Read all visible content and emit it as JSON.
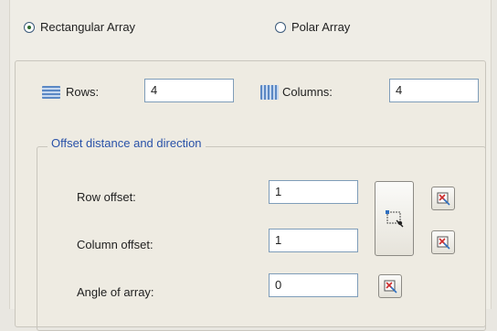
{
  "array_type": {
    "rectangular_label": "Rectangular Array",
    "polar_label": "Polar Array",
    "selected": "rectangular"
  },
  "grid": {
    "rows_label": "Rows:",
    "rows_value": "4",
    "columns_label": "Columns:",
    "columns_value": "4"
  },
  "offset": {
    "group_title": "Offset distance and direction",
    "row_offset_label": "Row offset:",
    "row_offset_value": "1",
    "column_offset_label": "Column offset:",
    "column_offset_value": "1",
    "angle_label": "Angle of array:",
    "angle_value": "0"
  },
  "icons": {
    "rows": "rows-icon",
    "columns": "columns-icon",
    "pick_both_offsets": "pick-both-offsets-icon",
    "pick_row_offset": "pick-row-offset-icon",
    "pick_column_offset": "pick-column-offset-icon",
    "pick_angle": "pick-angle-icon"
  },
  "colors": {
    "group_title": "#2a52a8",
    "field_border": "#7f9db9",
    "radio_selected": "#2d6b2d"
  }
}
